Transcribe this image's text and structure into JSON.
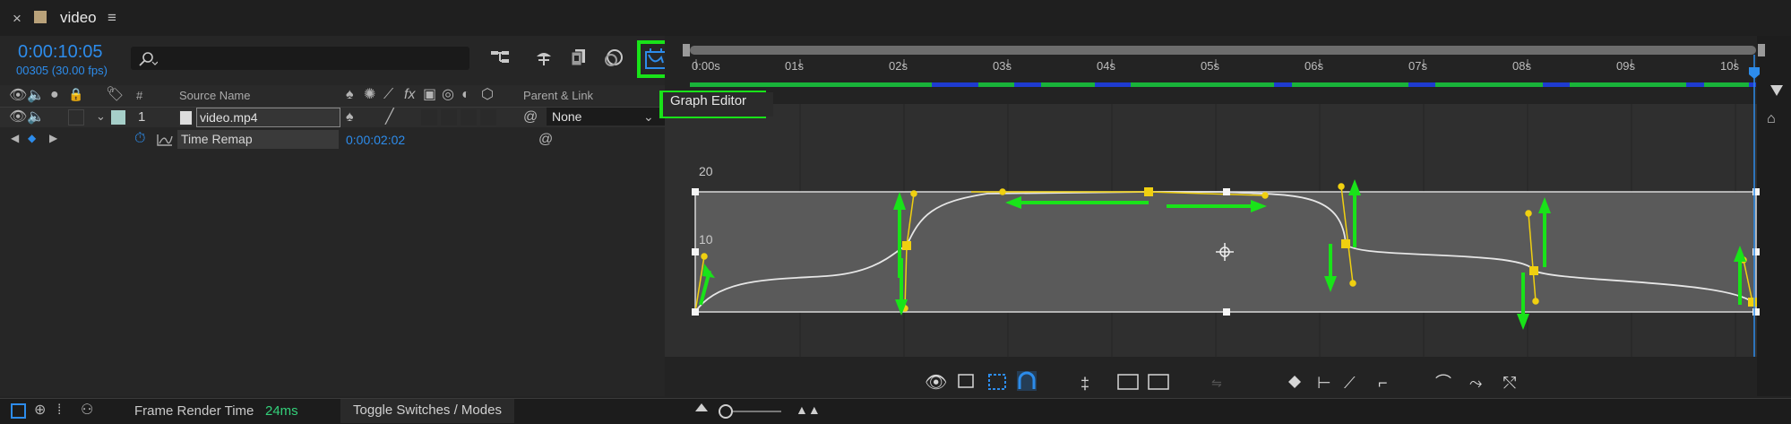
{
  "tab": {
    "close": "×",
    "title": "video",
    "menu": "≡"
  },
  "time": {
    "current": "0:00:10:05",
    "frames": "00305 (30.00 fps)"
  },
  "search": {
    "placeholder": ""
  },
  "columns": {
    "hash": "#",
    "source_name": "Source Name",
    "parent_link": "Parent & Link"
  },
  "layer": {
    "number": "1",
    "name": "video.mp4",
    "parent_value": "None"
  },
  "property": {
    "name": "Time Remap",
    "value": "0:00:02:02"
  },
  "ruler": {
    "labels": [
      "0:00s",
      "01s",
      "02s",
      "03s",
      "04s",
      "05s",
      "06s",
      "07s",
      "08s",
      "09s",
      "10s"
    ]
  },
  "tooltip": {
    "text": "Graph Editor"
  },
  "graph": {
    "y_labels": [
      "20",
      "10"
    ]
  },
  "bottom": {
    "render_label": "Frame Render Time",
    "render_value": "24ms",
    "toggle": "Toggle Switches / Modes"
  },
  "colors": {
    "accent_blue": "#2d8ceb",
    "highlight_green": "#19e319",
    "keyframe_yellow": "#f0d010",
    "render_green": "#33d17a"
  },
  "icons": [
    "close-icon",
    "composition-swatch-icon",
    "menu-icon",
    "search-icon",
    "comp-flowchart-icon",
    "draft-3d-icon",
    "frame-blending-icon",
    "motion-blur-icon",
    "graph-editor-icon",
    "eye-icon",
    "audio-icon",
    "solo-icon",
    "lock-icon",
    "label-icon",
    "shy-icon",
    "sun-icon",
    "fx-icon",
    "stopwatch-icon",
    "graph-icon",
    "spiral-pickwhip-icon",
    "current-time-indicator-icon"
  ]
}
